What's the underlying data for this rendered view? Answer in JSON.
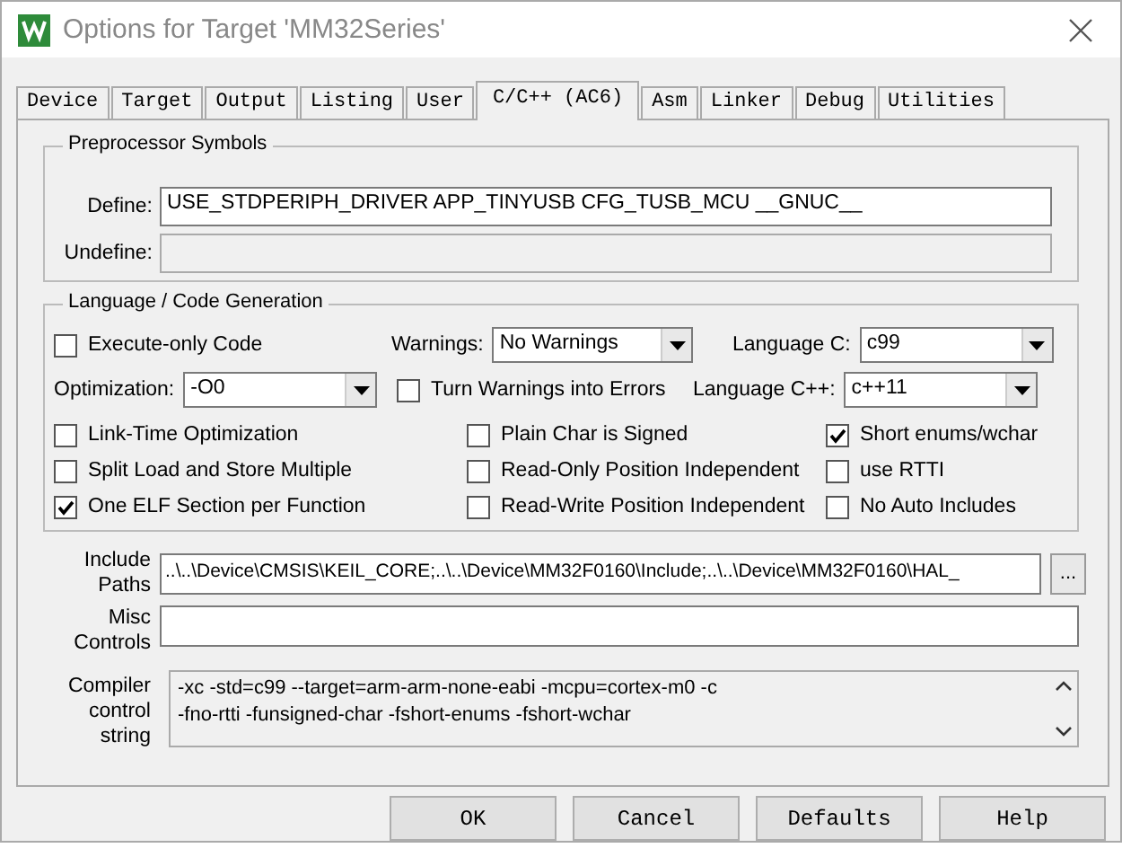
{
  "window": {
    "title": "Options for Target 'MM32Series'"
  },
  "tabs": [
    {
      "label": "Device",
      "selected": false
    },
    {
      "label": "Target",
      "selected": false
    },
    {
      "label": "Output",
      "selected": false
    },
    {
      "label": "Listing",
      "selected": false
    },
    {
      "label": "User",
      "selected": false
    },
    {
      "label": "C/C++ (AC6)",
      "selected": true
    },
    {
      "label": "Asm",
      "selected": false
    },
    {
      "label": "Linker",
      "selected": false
    },
    {
      "label": "Debug",
      "selected": false
    },
    {
      "label": "Utilities",
      "selected": false
    }
  ],
  "preprocessor": {
    "title": "Preprocessor Symbols",
    "fields": [
      {
        "label": "Define:",
        "value": "USE_STDPERIPH_DRIVER APP_TINYUSB CFG_TUSB_MCU __GNUC__",
        "disabled": false
      },
      {
        "label": "Undefine:",
        "disabled": true
      }
    ]
  },
  "language": {
    "title": "Language / Code Generation",
    "rows": [
      {
        "items": [
          {
            "kind": "checkbox",
            "label": "Execute-only Code",
            "checked": false
          },
          {
            "kind": "select",
            "label": "Warnings:",
            "value": "No Warnings"
          },
          {
            "kind": "select",
            "label": "Language C:",
            "value": "c99"
          }
        ]
      },
      {
        "items": [
          {
            "kind": "select",
            "label": "Optimization:",
            "value": "-O0"
          },
          {
            "kind": "checkbox",
            "label": "Turn Warnings into Errors",
            "checked": false
          },
          {
            "kind": "select",
            "label": "Language C++:",
            "value": "c++11"
          }
        ]
      },
      {
        "items": [
          {
            "kind": "checkbox",
            "label": "Link-Time Optimization",
            "checked": false
          },
          {
            "kind": "checkbox",
            "label": "Plain Char is Signed",
            "checked": false
          },
          {
            "kind": "checkbox",
            "label": "Short enums/wchar",
            "checked": true
          }
        ]
      },
      {
        "items": [
          {
            "kind": "checkbox",
            "label": "Split Load and Store Multiple",
            "checked": false
          },
          {
            "kind": "checkbox",
            "label": "Read-Only Position Independent",
            "checked": false
          },
          {
            "kind": "checkbox",
            "label": "use RTTI",
            "checked": false
          }
        ]
      },
      {
        "items": [
          {
            "kind": "checkbox",
            "label": "One ELF Section per Function",
            "checked": true
          },
          {
            "kind": "checkbox",
            "label": "Read-Write Position Independent",
            "checked": false
          },
          {
            "kind": "checkbox",
            "label": "No Auto Includes",
            "checked": false
          }
        ]
      }
    ]
  },
  "include_paths": {
    "label": "Include Paths",
    "value": "..\\..\\Device\\CMSIS\\KEIL_CORE;..\\..\\Device\\MM32F0160\\Include;..\\..\\Device\\MM32F0160\\HAL_",
    "browse": "..."
  },
  "misc_controls": {
    "label": "Misc Controls"
  },
  "compiler_string": {
    "label": "Compiler control string",
    "lines": [
      "-xc -std=c99 --target=arm-arm-none-eabi -mcpu=cortex-m0 -c",
      "-fno-rtti -funsigned-char -fshort-enums -fshort-wchar"
    ]
  },
  "buttons": [
    "OK",
    "Cancel",
    "Defaults",
    "Help"
  ]
}
